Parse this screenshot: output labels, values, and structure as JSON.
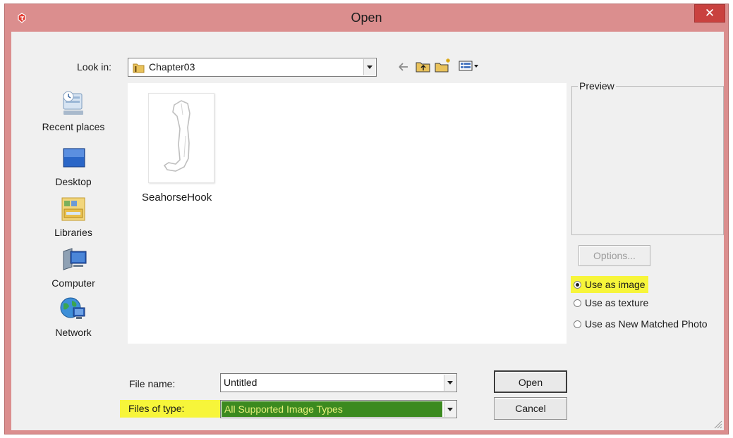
{
  "window": {
    "title": "Open",
    "close_glyph": "✕",
    "title_bg": "#db8e8e",
    "close_bg": "#c9413f"
  },
  "look_in": {
    "label": "Look in:",
    "value": "Chapter03"
  },
  "toolbar": {
    "icons": [
      "back-arrow-icon",
      "up-folder-icon",
      "new-folder-icon",
      "view-menu-icon"
    ]
  },
  "places": [
    {
      "label": "Recent places",
      "icon": "recent-places-icon"
    },
    {
      "label": "Desktop",
      "icon": "desktop-icon"
    },
    {
      "label": "Libraries",
      "icon": "libraries-icon"
    },
    {
      "label": "Computer",
      "icon": "computer-icon"
    },
    {
      "label": "Network",
      "icon": "network-icon"
    }
  ],
  "files": [
    {
      "name": "SeahorseHook"
    }
  ],
  "preview": {
    "label": "Preview"
  },
  "options_button": {
    "label": "Options..."
  },
  "import_mode": {
    "options": [
      {
        "label": "Use as image",
        "checked": true
      },
      {
        "label": "Use as texture",
        "checked": false
      },
      {
        "label": "Use as New Matched Photo",
        "checked": false
      }
    ],
    "highlight_color": "#f7f53a"
  },
  "file_name": {
    "label": "File name:",
    "value": "Untitled"
  },
  "file_type": {
    "label": "Files of type:",
    "value": "All Supported Image Types",
    "selected_bg": "#3b8a1f"
  },
  "buttons": {
    "open": "Open",
    "cancel": "Cancel"
  }
}
